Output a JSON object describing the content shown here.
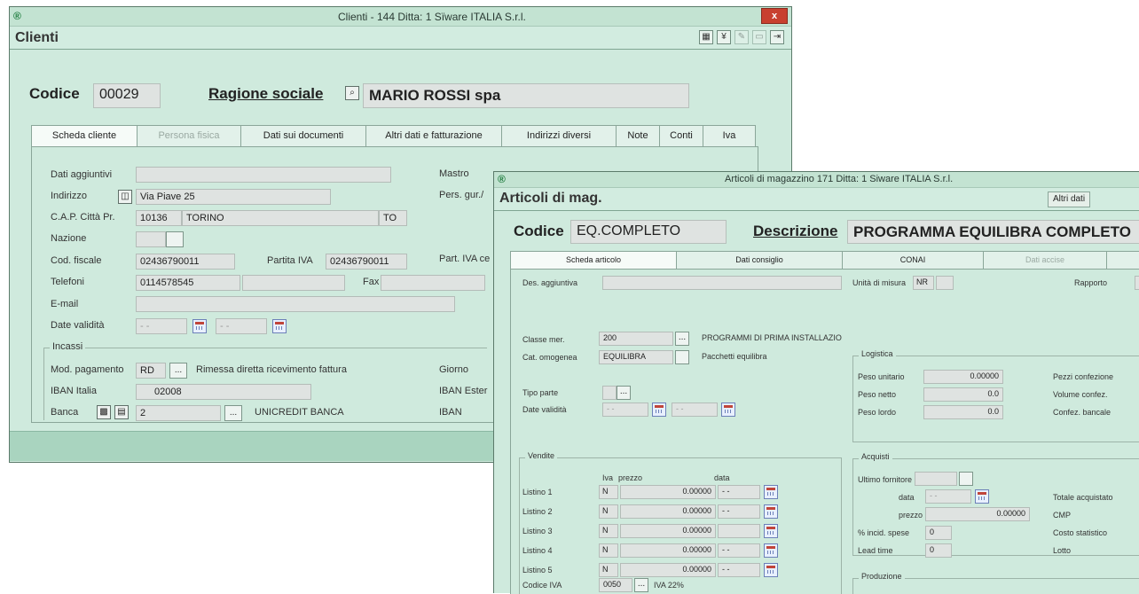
{
  "clienti": {
    "window_title": "Clienti - 144    Ditta: 1  Sïware ITALIA S.r.l.",
    "close_label": "x",
    "header_title": "Clienti",
    "toolbar_icons": [
      "grid-icon",
      "tree-icon",
      "edit-icon",
      "save-icon",
      "exit-icon"
    ],
    "codice_label": "Codice",
    "codice_value": "00029",
    "ragione_label": "Ragione sociale",
    "ragione_value": "MARIO ROSSI spa",
    "tabs": [
      "Scheda cliente",
      "Persona fisica",
      "Dati sui documenti",
      "Altri dati e fatturazione",
      "Indirizzi diversi",
      "Note",
      "Conti",
      "Iva"
    ],
    "dati_aggiuntivi_label": "Dati aggiuntivi",
    "mastro_label": "Mastro",
    "indirizzo_label": "Indirizzo",
    "indirizzo_value": "Via Piave 25",
    "pers_gruppo_label": "Pers. gur./",
    "cap_label": "C.A.P.  Città  Pr.",
    "cap_value": "10136",
    "citta_value": "TORINO",
    "provincia_value": "TO",
    "nazione_label": "Nazione",
    "cod_fiscale_label": "Cod. fiscale",
    "cod_fiscale_value": "02436790011",
    "partita_iva_label": "Partita IVA",
    "partita_iva_value": "02436790011",
    "part_iva_cee_label": "Part. IVA ce",
    "telefoni_label": "Telefoni",
    "telefoni_value": "0114578545",
    "fax_label": "Fax",
    "email_label": "E-mail",
    "date_validita_label": "Date validità",
    "date_placeholder": "- -",
    "incassi_title": "Incassi",
    "mod_pagamento_label": "Mod. pagamento",
    "mod_pagamento_value": "RD",
    "mod_pagamento_desc": "Rimessa diretta ricevimento fattura",
    "giorno_label": "Giorno",
    "iban_italia_label": "IBAN Italia",
    "iban_italia_value": "02008",
    "iban_estero_label": "IBAN Ester",
    "banca_label": "Banca",
    "banca_value": "2",
    "banca_desc": "UNICREDIT BANCA",
    "iban_label": "IBAN"
  },
  "articoli": {
    "window_title": "Articoli di magazzino  171   Ditta: 1  Siware ITALIA S.r.l.",
    "header_title": "Articoli di mag.",
    "altri_dati_label": "Altri dati",
    "codice_label": "Codice",
    "codice_value": "EQ.COMPLETO",
    "descrizione_label": "Descrizione",
    "descrizione_value": "PROGRAMMA EQUILIBRA COMPLETO",
    "tabs": [
      "Scheda articolo",
      "Dati consiglio",
      "CONAI",
      "Dati accise",
      ""
    ],
    "des_aggiuntiva_label": "Des. aggiuntiva",
    "unita_misura_label": "Unità di misura",
    "unita_misura_value": "NR",
    "rapporto_label": "Rapporto",
    "classe_mer_label": "Classe mer.",
    "classe_mer_value": "200",
    "classe_mer_desc": "PROGRAMMI DI PRIMA INSTALLAZIO",
    "cat_omogenea_label": "Cat. omogenea",
    "cat_omogenea_value": "EQUILIBRA",
    "cat_omogenea_desc": "Pacchetti equilibra",
    "tipo_parte_label": "Tipo parte",
    "date_validita_label": "Date validità",
    "date_placeholder": "- -",
    "logistica_title": "Logistica",
    "peso_unitario_label": "Peso unitario",
    "peso_unitario_value": "0.00000",
    "peso_netto_label": "Peso netto",
    "peso_netto_value": "0.0",
    "peso_lordo_label": "Peso lordo",
    "peso_lordo_value": "0.0",
    "pezzi_confezione_label": "Pezzi confezione",
    "volume_confez_label": "Volume confez.",
    "confez_bancale_label": "Confez. bancale",
    "vendite_title": "Vendite",
    "col_iva": "Iva",
    "col_prezzo": "prezzo",
    "col_data": "data",
    "listini": [
      {
        "label": "Listino 1",
        "iva": "N",
        "prezzo": "0.00000",
        "data": "- -"
      },
      {
        "label": "Listino 2",
        "iva": "N",
        "prezzo": "0.00000",
        "data": "- -"
      },
      {
        "label": "Listino 3",
        "iva": "N",
        "prezzo": "0.00000",
        "data": ""
      },
      {
        "label": "Listino 4",
        "iva": "N",
        "prezzo": "0.00000",
        "data": "- -"
      },
      {
        "label": "Listino 5",
        "iva": "N",
        "prezzo": "0.00000",
        "data": "- -"
      }
    ],
    "codice_iva_label": "Codice IVA",
    "codice_iva_value": "0050",
    "codice_iva_desc": "IVA 22%",
    "acquisti_title": "Acquisti",
    "ultimo_fornitore_label": "Ultimo fornitore",
    "acq_data_label": "data",
    "acq_prezzo_label": "prezzo",
    "acq_prezzo_value": "0.00000",
    "incid_spese_label": "% incid. spese",
    "incid_spese_value": "0",
    "lead_time_label": "Lead time",
    "lead_time_value": "0",
    "totale_acquistato_label": "Totale acquistato",
    "cmp_label": "CMP",
    "costo_statistico_label": "Costo statistico",
    "lotto_label": "Lotto",
    "produzione_title": "Produzione"
  }
}
